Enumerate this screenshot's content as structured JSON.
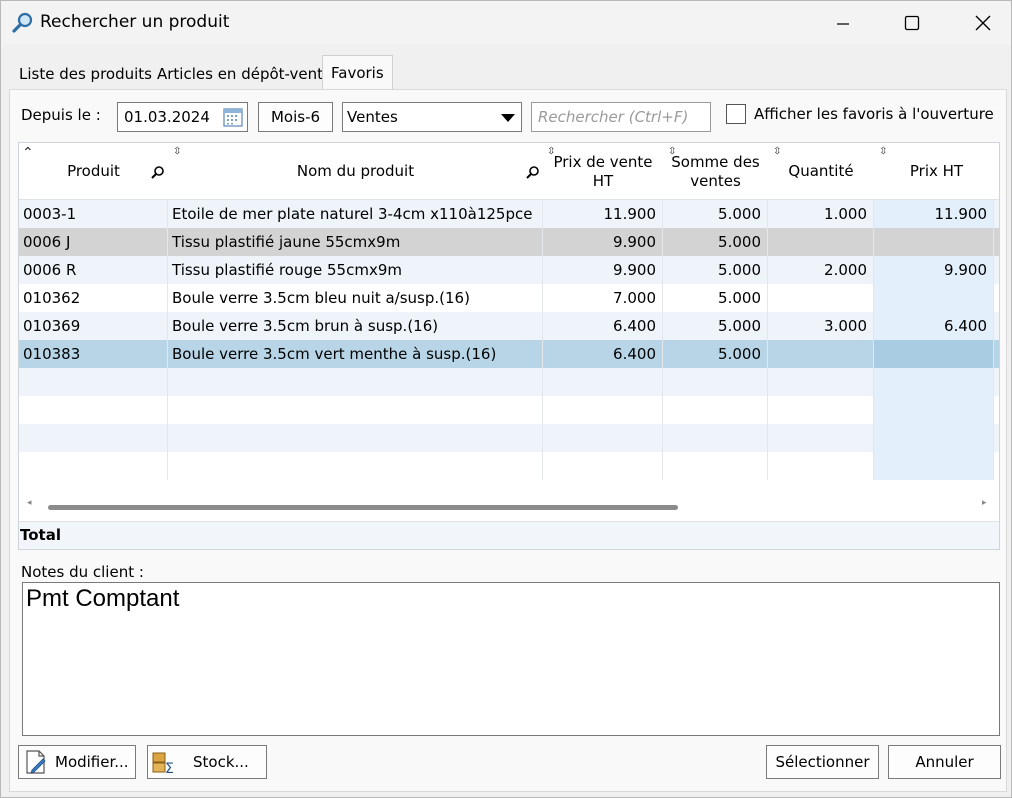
{
  "window": {
    "title": "Rechercher un produit"
  },
  "tabs": [
    {
      "label": "Liste des produits"
    },
    {
      "label": "Articles en dépôt-vente"
    },
    {
      "label": "Favoris"
    }
  ],
  "filters": {
    "since_label": "Depuis le :",
    "date_value": "01.03.2024",
    "period_button": "Mois-6",
    "type_select": "Ventes",
    "search_placeholder": "Rechercher (Ctrl+F)",
    "show_favorites_label": "Afficher les favoris à l'ouverture"
  },
  "grid": {
    "columns": [
      "Produit",
      "Nom du produit",
      "Prix de vente HT",
      "Somme des ventes",
      "Quantité",
      "Prix HT"
    ],
    "rows": [
      {
        "code": "0003-1",
        "name": "Etoile de mer plate naturel 3-4cm x110à125pce",
        "price": "11.900",
        "sum": "5.000",
        "qty": "1.000",
        "prix_ht": "11.900"
      },
      {
        "code": "0006 J",
        "name": "Tissu plastifié jaune 55cmx9m",
        "price": "9.900",
        "sum": "5.000",
        "qty": "",
        "prix_ht": ""
      },
      {
        "code": "0006 R",
        "name": "Tissu plastifié rouge 55cmx9m",
        "price": "9.900",
        "sum": "5.000",
        "qty": "2.000",
        "prix_ht": "9.900"
      },
      {
        "code": "010362",
        "name": "Boule verre 3.5cm bleu nuit a/susp.(16)",
        "price": "7.000",
        "sum": "5.000",
        "qty": "",
        "prix_ht": ""
      },
      {
        "code": "010369",
        "name": "Boule verre 3.5cm brun à susp.(16)",
        "price": "6.400",
        "sum": "5.000",
        "qty": "3.000",
        "prix_ht": "6.400"
      },
      {
        "code": "010383",
        "name": "Boule verre 3.5cm vert menthe à susp.(16)",
        "price": "6.400",
        "sum": "5.000",
        "qty": "",
        "prix_ht": ""
      }
    ],
    "total_label": "Total"
  },
  "notes": {
    "label": "Notes du client :",
    "text": "Pmt Comptant"
  },
  "buttons": {
    "modify": "Modifier...",
    "stock": "Stock...",
    "select": "Sélectionner",
    "cancel": "Annuler"
  }
}
